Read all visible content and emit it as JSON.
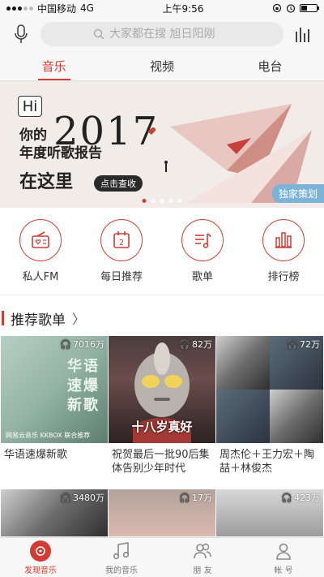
{
  "status_bar": {
    "carrier": "中国移动",
    "network": "4G",
    "time": "上午9:56"
  },
  "search": {
    "placeholder": "大家都在搜 旭日阳刚"
  },
  "tabs": [
    {
      "label": "音乐",
      "active": true
    },
    {
      "label": "视频",
      "active": false
    },
    {
      "label": "电台",
      "active": false
    }
  ],
  "banner": {
    "hi": "Hi",
    "line1": "你的",
    "year": "2017",
    "line2": "年度听歌报告",
    "line3": "在这里",
    "button": "点击查收",
    "tag": "独家策划"
  },
  "quick_entries": [
    {
      "label": "私人FM",
      "icon": "radio-icon"
    },
    {
      "label": "每日推荐",
      "icon": "calendar-icon",
      "day": "2"
    },
    {
      "label": "歌单",
      "icon": "playlist-icon"
    },
    {
      "label": "排行榜",
      "icon": "chart-icon"
    }
  ],
  "section": {
    "title": "推荐歌单",
    "chevron": "〉"
  },
  "playlists": [
    {
      "count": "7016万",
      "title": "华语速爆新歌",
      "cover_text": [
        "华语",
        "速爆",
        "新歌"
      ],
      "cover_foot": "网易云音乐  KKBOX 联合推荐"
    },
    {
      "count": "82万",
      "title": "祝贺最后一批90后集体告别少年时代",
      "cover_text": "十八岁真好"
    },
    {
      "count": "72万",
      "title": "周杰伦＋王力宏＋陶喆＋林俊杰"
    },
    {
      "count": "3480万",
      "title": ""
    },
    {
      "count": "17万",
      "title": ""
    },
    {
      "count": "423万",
      "title": ""
    }
  ],
  "bottom_nav": [
    {
      "label": "发现音乐",
      "active": true
    },
    {
      "label": "我的音乐",
      "active": false
    },
    {
      "label": "朋 友",
      "active": false
    },
    {
      "label": "帐 号",
      "active": false
    }
  ],
  "colors": {
    "accent": "#d43c33",
    "tag_blue": "#7cb4d8"
  }
}
